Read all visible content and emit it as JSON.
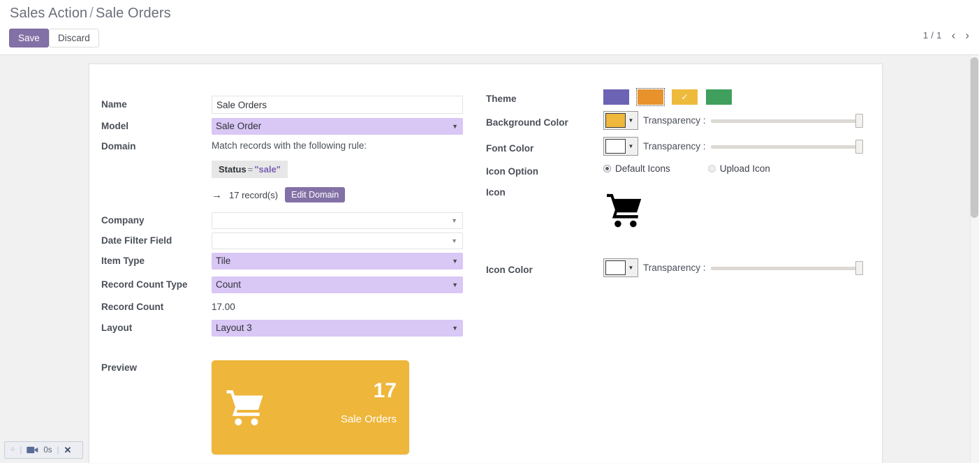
{
  "header": {
    "breadcrumb_root": "Sales Action",
    "breadcrumb_sep": "/",
    "breadcrumb_current": "Sale Orders",
    "save_label": "Save",
    "discard_label": "Discard",
    "pager_count": "1 / 1",
    "pager_prev": "‹",
    "pager_next": "›"
  },
  "form": {
    "name": {
      "label": "Name",
      "value": "Sale Orders"
    },
    "model": {
      "label": "Model",
      "value": "Sale Order"
    },
    "domain": {
      "label": "Domain",
      "hint": "Match records with the following rule:",
      "rule_field": "Status",
      "rule_operator": "=",
      "rule_value": "\"sale\"",
      "arrow": "→",
      "record_count": "17 record(s)",
      "edit_button": "Edit Domain"
    },
    "company": {
      "label": "Company",
      "value": ""
    },
    "date_filter_field": {
      "label": "Date Filter Field",
      "value": ""
    },
    "item_type": {
      "label": "Item Type",
      "value": "Tile"
    },
    "record_count_type": {
      "label": "Record Count Type",
      "value": "Count"
    },
    "record_count": {
      "label": "Record Count",
      "value": "17.00"
    },
    "layout": {
      "label": "Layout",
      "value": "Layout 3"
    },
    "preview": {
      "label": "Preview"
    }
  },
  "style_panel": {
    "theme": {
      "label": "Theme",
      "swatches": [
        {
          "name": "theme-purple",
          "color": "#6c63b5",
          "selected": false,
          "focused": false
        },
        {
          "name": "theme-orange",
          "color": "#e8922e",
          "selected": false,
          "focused": true
        },
        {
          "name": "theme-amber",
          "color": "#eeba3c",
          "selected": true,
          "focused": false
        },
        {
          "name": "theme-green",
          "color": "#3f9f5c",
          "selected": false,
          "focused": false
        }
      ],
      "check_glyph": "✓"
    },
    "background_color": {
      "label": "Background Color",
      "swatch": "#eeb83c",
      "transparency_label": "Transparency :",
      "transparency_value": 100
    },
    "font_color": {
      "label": "Font Color",
      "swatch": "#ffffff",
      "transparency_label": "Transparency :",
      "transparency_value": 100
    },
    "icon_option": {
      "label": "Icon Option",
      "options": [
        {
          "label": "Default Icons",
          "selected": true
        },
        {
          "label": "Upload Icon",
          "selected": false
        }
      ]
    },
    "icon": {
      "label": "Icon",
      "glyph_name": "shopping-cart-icon",
      "color": "#000000"
    },
    "icon_color": {
      "label": "Icon Color",
      "swatch": "#ffffff",
      "transparency_label": "Transparency :",
      "transparency_value": 100
    },
    "caret_glyph": "▼"
  },
  "preview_tile": {
    "background": "#eeb63a",
    "count": "17",
    "name": "Sale Orders",
    "icon_name": "shopping-cart-icon",
    "icon_color": "#ffffff"
  },
  "recorder": {
    "handle_glyph": "⁘",
    "divider": "|",
    "camera_name": "video-camera-icon",
    "time": "0s",
    "close_glyph": "✕"
  }
}
